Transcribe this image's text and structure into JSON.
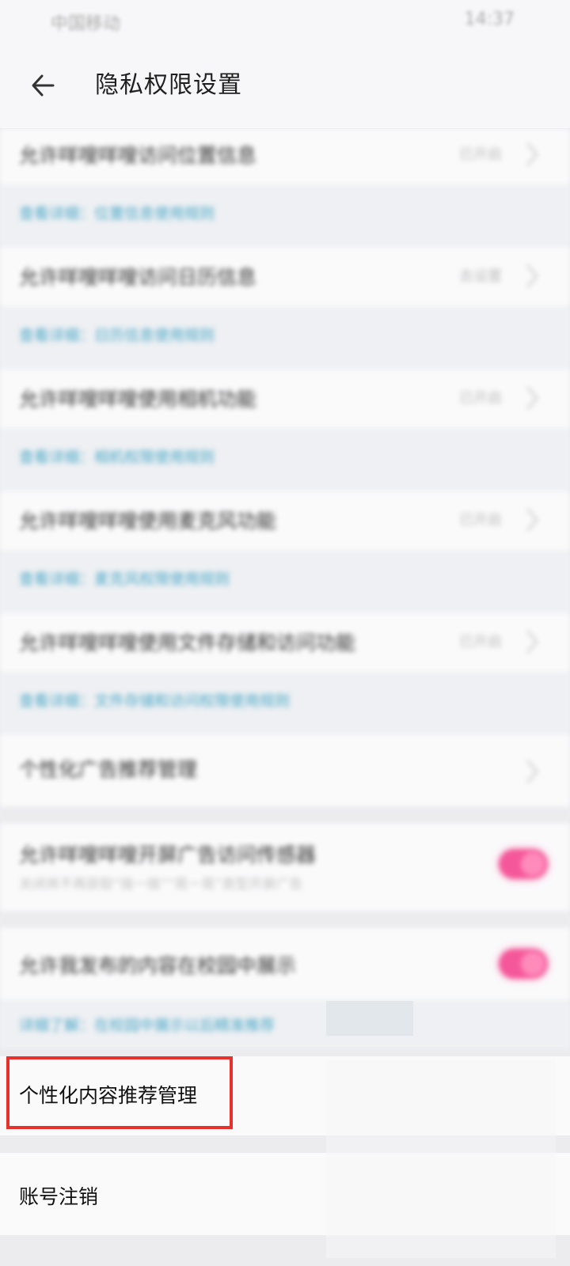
{
  "statusbar": {
    "carrier": "中国移动",
    "time": "14:37"
  },
  "header": {
    "title": "隐私权限设置",
    "back_icon": "arrow-left-icon"
  },
  "permissions": [
    {
      "label": "允许咩嗖咩嗖访问位置信息",
      "state": "已开启",
      "note": "查看详细：位置信息使用规则"
    },
    {
      "label": "允许咩嗖咩嗖访问日历信息",
      "state": "去设置",
      "note": "查看详细：日历信息使用规则"
    },
    {
      "label": "允许咩嗖咩嗖使用相机功能",
      "state": "已开启",
      "note": "查看详细：相机权限使用规则"
    },
    {
      "label": "允许咩嗖咩嗖使用麦克风功能",
      "state": "已开启",
      "note": "查看详细：麦克风权限使用规则"
    },
    {
      "label": "允许咩嗖咩嗖使用文件存储和访问功能",
      "state": "已开启",
      "note": "查看详细：文件存储和访问权限使用规则"
    }
  ],
  "ad_management": {
    "label": "个性化广告推荐管理"
  },
  "toggles": [
    {
      "label": "允许咩嗖咩嗖开屏广告访问传感器",
      "sub": "关闭将不再获取“摇一摇”“晃一晃”类型开屏广告",
      "on": true
    },
    {
      "label": "允许我发布的内容在校园中展示",
      "sub": "",
      "on": true
    }
  ],
  "toggle_note": "详细了解：在校园中展示以后精准推荐",
  "content_management": {
    "label": "个性化内容推荐管理"
  },
  "account_cancel": {
    "label": "账号注销"
  },
  "colors": {
    "accent_pink": "#f5589a",
    "link_blue": "#4aa7c7",
    "highlight_red": "#e8302c"
  }
}
